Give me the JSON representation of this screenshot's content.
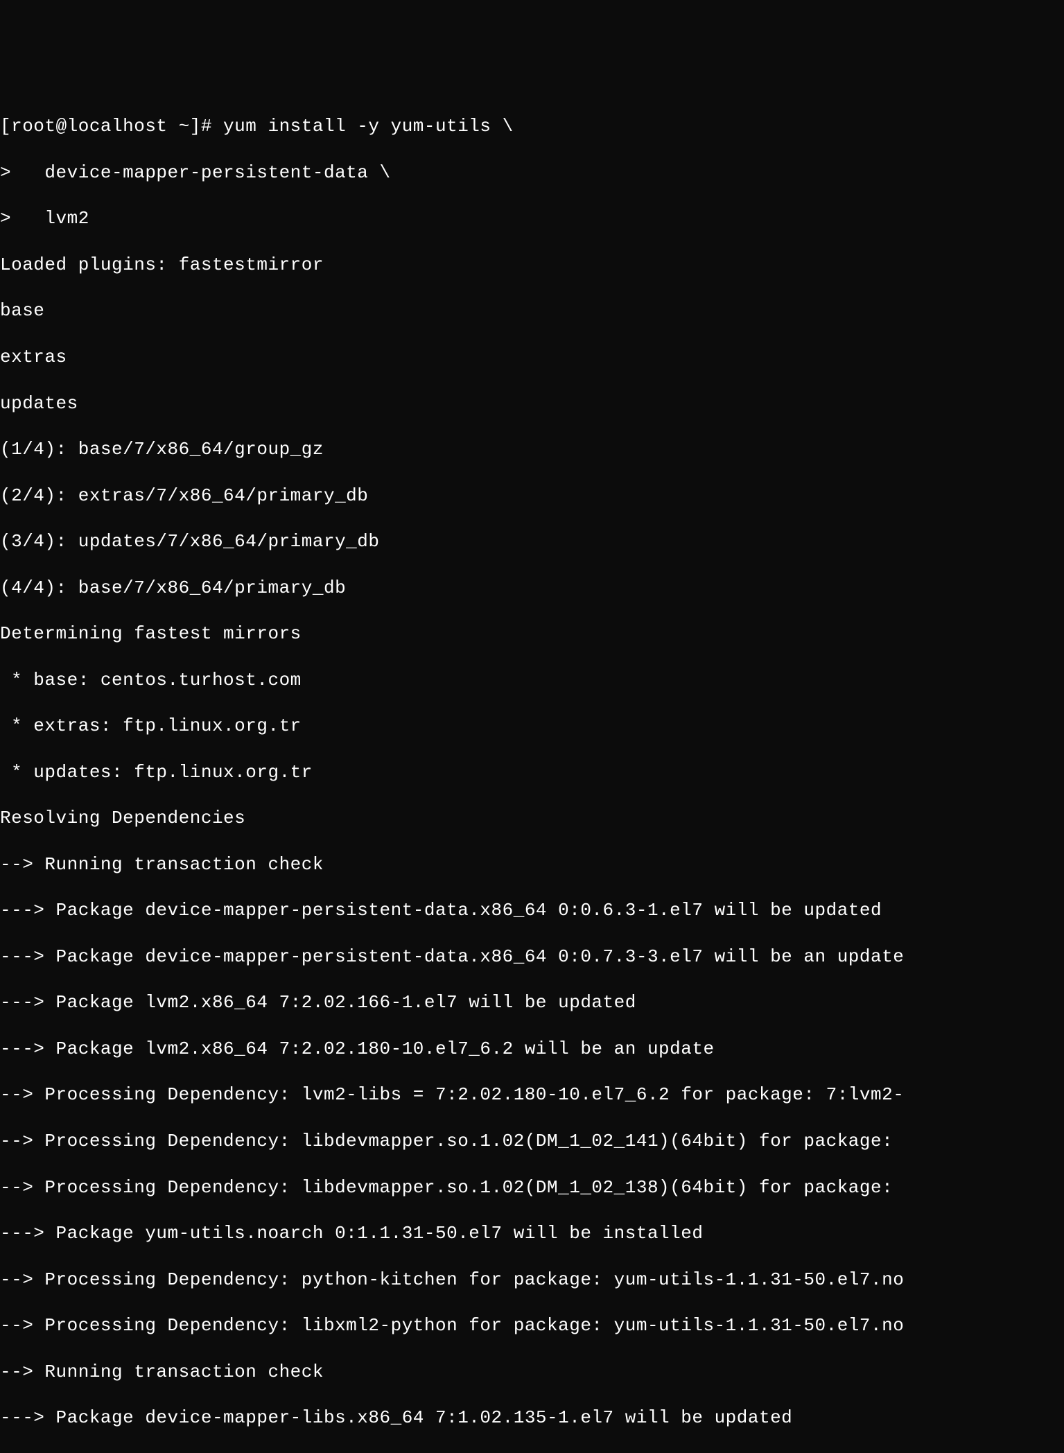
{
  "terminal": {
    "lines": [
      "[root@localhost ~]# yum install -y yum-utils \\",
      ">   device-mapper-persistent-data \\",
      ">   lvm2",
      "Loaded plugins: fastestmirror",
      "base",
      "extras",
      "updates",
      "(1/4): base/7/x86_64/group_gz",
      "(2/4): extras/7/x86_64/primary_db",
      "(3/4): updates/7/x86_64/primary_db",
      "(4/4): base/7/x86_64/primary_db",
      "Determining fastest mirrors",
      " * base: centos.turhost.com",
      " * extras: ftp.linux.org.tr",
      " * updates: ftp.linux.org.tr",
      "Resolving Dependencies",
      "--> Running transaction check",
      "---> Package device-mapper-persistent-data.x86_64 0:0.6.3-1.el7 will be updated",
      "---> Package device-mapper-persistent-data.x86_64 0:0.7.3-3.el7 will be an update",
      "---> Package lvm2.x86_64 7:2.02.166-1.el7 will be updated",
      "---> Package lvm2.x86_64 7:2.02.180-10.el7_6.2 will be an update",
      "--> Processing Dependency: lvm2-libs = 7:2.02.180-10.el7_6.2 for package: 7:lvm2-",
      "--> Processing Dependency: libdevmapper.so.1.02(DM_1_02_141)(64bit) for package: ",
      "--> Processing Dependency: libdevmapper.so.1.02(DM_1_02_138)(64bit) for package: ",
      "---> Package yum-utils.noarch 0:1.1.31-50.el7 will be installed",
      "--> Processing Dependency: python-kitchen for package: yum-utils-1.1.31-50.el7.no",
      "--> Processing Dependency: libxml2-python for package: yum-utils-1.1.31-50.el7.no",
      "--> Running transaction check",
      "---> Package device-mapper-libs.x86_64 7:1.02.135-1.el7 will be updated"
    ]
  }
}
